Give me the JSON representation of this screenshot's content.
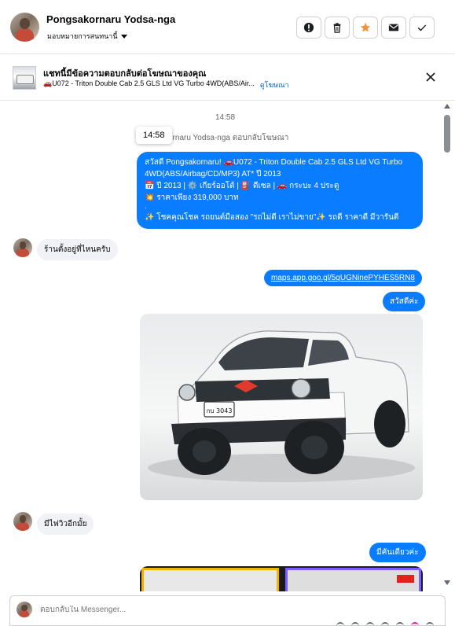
{
  "header": {
    "name": "Pongsakornaru Yodsa-nga",
    "assign": "มอบหมายการสนทนานี้",
    "actions": [
      "report-icon",
      "trash-icon",
      "star-icon",
      "mail-icon",
      "check-icon"
    ],
    "star_color": "#f7923a"
  },
  "ad": {
    "title": "แชทนี้มีข้อความตอบกลับต่อโฆษณาของคุณ",
    "car_line": "🚗U072 - Triton Double Cab 2.5 GLS Ltd VG Turbo 4WD(ABS/Air...",
    "view_ad": "ดูโฆษณา"
  },
  "thread": {
    "time": "14:58",
    "tooltip": "14:58",
    "replied_prefix": "ornaru Yodsa-nga ตอบกลับโฆษณา",
    "ad_message": [
      "สวัสดี Pongsakornaru! 🚗U072 - Triton Double Cab 2.5 GLS Ltd VG Turbo",
      "4WD(ABS/Airbag/CD/MP3) AT* ปี 2013",
      "📅 ปี 2013 | ⚙️ เกียร์ออโต้ | ⛽ ดีเซล | 🚗 กระบะ 4 ประตู",
      "💥 ราคาเพียง 319,000 บาท",
      ".",
      "✨ โชคคุณโชค รถยนต์มือสอง \"รถไม่ดี เราไม่ขาย\"✨ รถดี ราคาดี มีวารันตี"
    ],
    "msg_in_1": "ร้านตั้งอยู่ที่ไหนครับ",
    "link": "maps.app.goo.gl/5qUGNinePYHES5RN8",
    "msg_out_hi": "สวัสดีค่ะ",
    "plate": "กบ 3043",
    "msg_in_2": "มีไฟวิวอีกมั้ย",
    "msg_out_one": "มีคันเดียวค่ะ"
  },
  "composer": {
    "placeholder": "ตอบกลับใน Messenger..."
  },
  "colors": {
    "accent": "#0a7cff",
    "link": "#0064d1"
  }
}
